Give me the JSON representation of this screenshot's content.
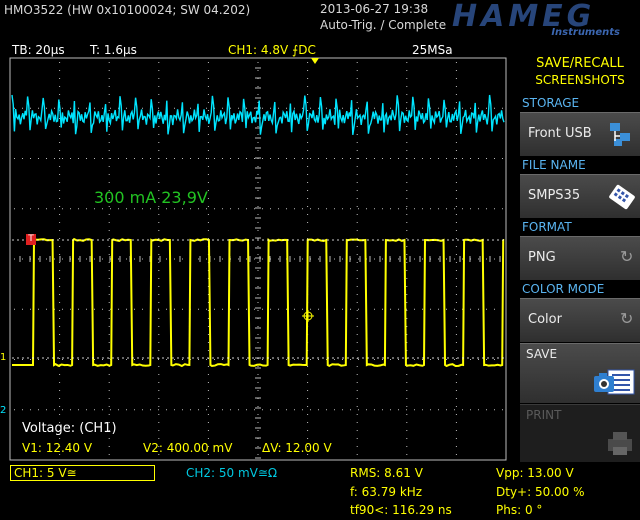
{
  "header": {
    "device": "HMO3522 (HW 0x10100024; SW 04.202)",
    "datetime": "2013-06-27 19:38",
    "trigger_status": "Auto-Trig. / Complete",
    "brand": "HAMEG",
    "brand_sub": "Instruments"
  },
  "status_bar": {
    "timebase": "TB: 20µs",
    "trigger_time": "T: 1.6µs",
    "ch1_trigger": "CH1: 4.8V ⨍DC",
    "sample_rate": "25MSa"
  },
  "screen": {
    "annotation": "300 mA 23,9V",
    "ch1_marker": "1",
    "ch2_marker": "2",
    "trig_marker": "T",
    "colors": {
      "ch1": "#ffff00",
      "ch2": "#00e5ff",
      "annotation": "#22c322",
      "grid": "#bdbdbd"
    }
  },
  "cursor_readout": {
    "title": "Voltage: (CH1)",
    "v1": "V1: 12.40 V",
    "v2": "V2: 400.00 mV",
    "dv": "ΔV: 12.00 V"
  },
  "side_menu": {
    "title_line1": "SAVE/RECALL",
    "title_line2": "SCREENSHOTS",
    "storage_header": "STORAGE",
    "storage_value": "Front USB",
    "storage_icon": "usb-icon",
    "file_name_header": "FILE NAME",
    "file_name_value": "SMPS35",
    "file_icon": "keyboard-icon",
    "format_header": "FORMAT",
    "format_value": "PNG",
    "color_mode_header": "COLOR MODE",
    "color_mode_value": "Color",
    "save_label": "SAVE",
    "save_icon": "camera-icon",
    "print_label": "PRINT",
    "print_icon": "printer-icon"
  },
  "bottom": {
    "ch1": "CH1: 5 V≅",
    "ch2": "CH2: 50 mV≅Ω",
    "rms": "RMS: 8.61 V",
    "freq": "f: 63.79 kHz",
    "fall": "tf90<: 116.29 ns",
    "vpp": "Vpp: 13.00 V",
    "duty": "Dty+: 50.00 %",
    "phase": "Phs: 0 °"
  },
  "waveforms": {
    "ch1_period_us": 15.68,
    "ch1_high_v": 12.4,
    "ch1_low_v": 0.4,
    "ch2_spike_count": 32
  }
}
